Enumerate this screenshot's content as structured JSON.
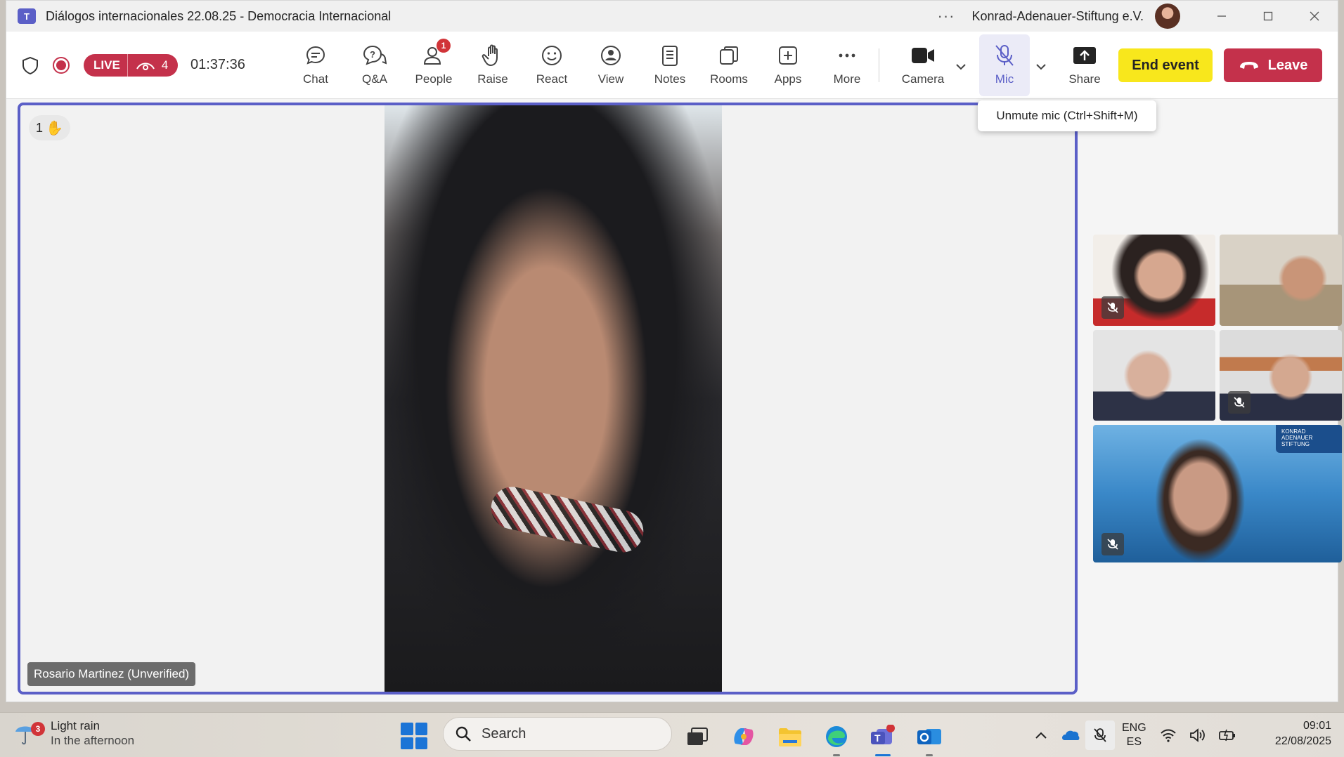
{
  "window": {
    "title": "Diálogos internacionales 22.08.25 - Democracia Internacional",
    "org_name": "Konrad-Adenauer-Stiftung e.V.",
    "app_icon_text": "T"
  },
  "toolbar": {
    "live_label": "LIVE",
    "viewer_count": "4",
    "elapsed": "01:37:36",
    "buttons": [
      {
        "id": "chat",
        "label": "Chat",
        "icon": "chat-icon"
      },
      {
        "id": "qa",
        "label": "Q&A",
        "icon": "qa-icon"
      },
      {
        "id": "people",
        "label": "People",
        "icon": "people-icon",
        "badge": "1"
      },
      {
        "id": "raise",
        "label": "Raise",
        "icon": "hand-icon"
      },
      {
        "id": "react",
        "label": "React",
        "icon": "smiley-icon"
      },
      {
        "id": "view",
        "label": "View",
        "icon": "view-icon"
      },
      {
        "id": "notes",
        "label": "Notes",
        "icon": "notes-icon"
      },
      {
        "id": "rooms",
        "label": "Rooms",
        "icon": "rooms-icon"
      },
      {
        "id": "apps",
        "label": "Apps",
        "icon": "plus-icon"
      },
      {
        "id": "more",
        "label": "More",
        "icon": "ellipsis-icon"
      }
    ],
    "camera_label": "Camera",
    "mic_label": "Mic",
    "share_label": "Share",
    "end_event_label": "End event",
    "leave_label": "Leave",
    "mic_tooltip": "Unmute mic (Ctrl+Shift+M)"
  },
  "stage": {
    "raised_hands_count": "1",
    "speaker_name": "Rosario Martinez (Unverified)"
  },
  "gallery": {
    "tiles": [
      {
        "muted": true
      },
      {
        "muted": false
      },
      {
        "muted": false
      },
      {
        "muted": true
      },
      {
        "muted": true,
        "logo_text": "KONRAD ADENAUER STIFTUNG"
      }
    ]
  },
  "taskbar": {
    "weather_badge": "3",
    "weather_title": "Light rain",
    "weather_subtitle": "In the afternoon",
    "search_label": "Search",
    "lang_top": "ENG",
    "lang_bottom": "ES",
    "time": "09:01",
    "date": "22/08/2025"
  },
  "colors": {
    "accent": "#5b5fc7",
    "live_red": "#c4314b",
    "end_event_yellow": "#f8e71c",
    "leave_red": "#c4314b"
  }
}
